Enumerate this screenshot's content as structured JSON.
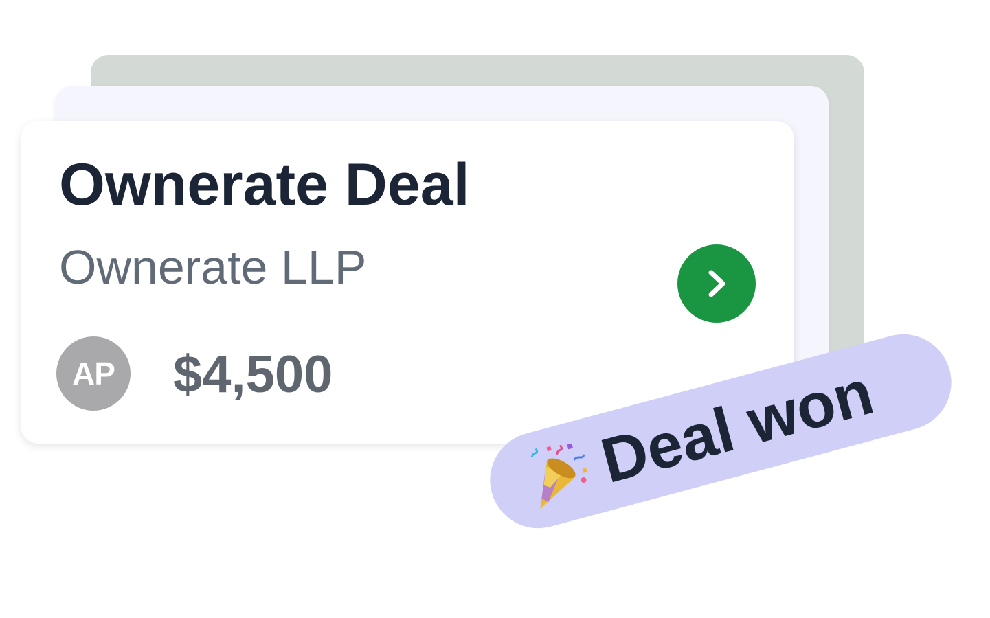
{
  "deal": {
    "title": "Ownerate Deal",
    "company": "Ownerate LLP",
    "owner_initials": "AP",
    "amount": "$4,500"
  },
  "badge": {
    "icon": "party-popper-icon",
    "label": "Deal won"
  },
  "colors": {
    "back_card": "#d3d9d5",
    "middle_card": "#f5f6fd",
    "front_card": "#ffffff",
    "title_text": "#1b2536",
    "company_text": "#616b78",
    "open_button": "#1a9643",
    "avatar": "#a9a9ab",
    "amount_text": "#606670",
    "badge_background": "#cfcff7"
  }
}
